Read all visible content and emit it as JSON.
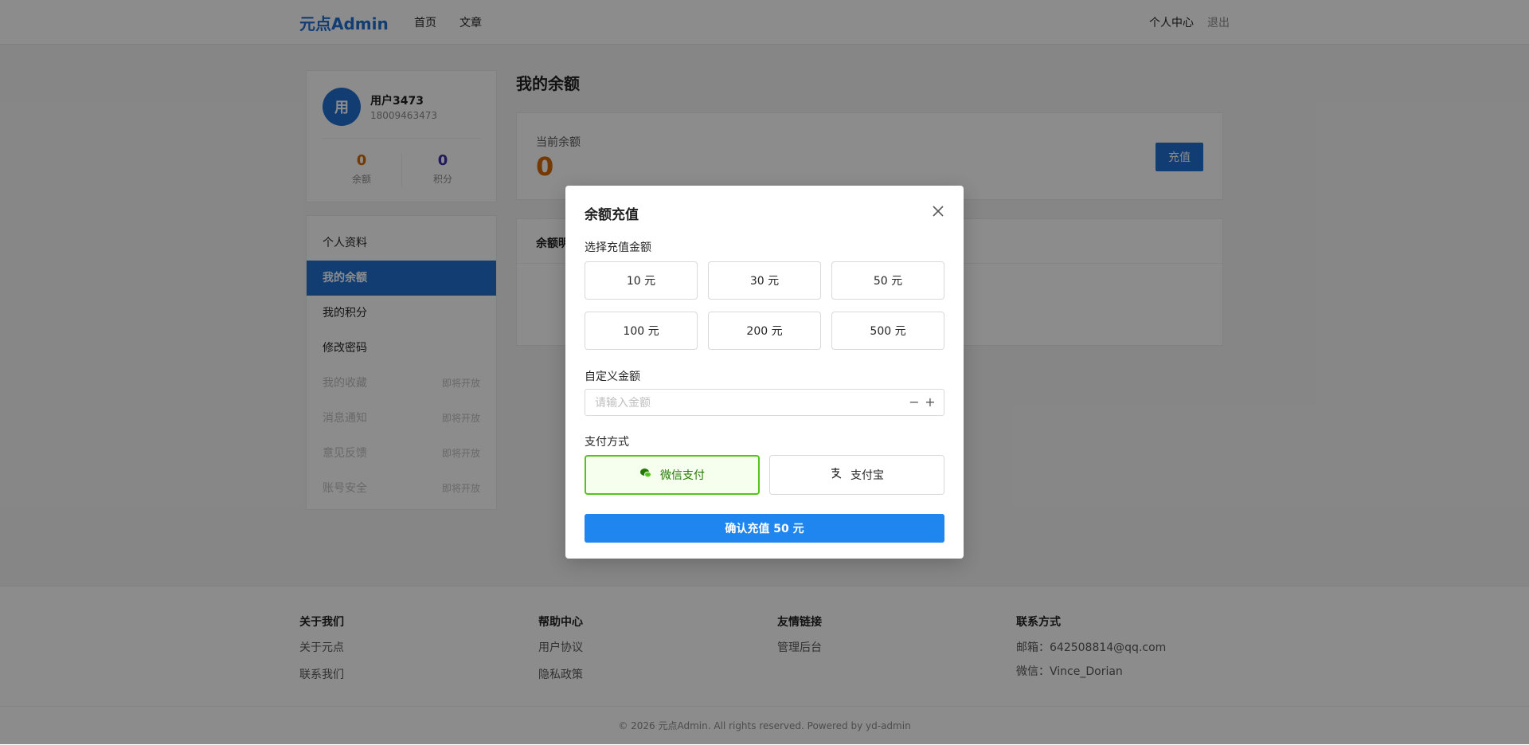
{
  "header": {
    "logo": "元点Admin",
    "nav": [
      "首页",
      "文章"
    ],
    "user_center": "个人中心",
    "logout": "退出"
  },
  "profile": {
    "avatar_char": "用",
    "name": "用户3473",
    "phone": "18009463473",
    "balance_value": "0",
    "balance_label": "余额",
    "points_value": "0",
    "points_label": "积分"
  },
  "menu": {
    "items": [
      {
        "label": "个人资料"
      },
      {
        "label": "我的余额"
      },
      {
        "label": "我的积分"
      },
      {
        "label": "修改密码"
      },
      {
        "label": "我的收藏",
        "badge": "即将开放"
      },
      {
        "label": "消息通知",
        "badge": "即将开放"
      },
      {
        "label": "意见反馈",
        "badge": "即将开放"
      },
      {
        "label": "账号安全",
        "badge": "即将开放"
      }
    ]
  },
  "main": {
    "title": "我的余额",
    "current_balance_label": "当前余额",
    "current_balance_value": "0",
    "recharge_button": "充值",
    "detail_title": "余额明"
  },
  "modal": {
    "title": "余额充值",
    "amount_label": "选择充值金额",
    "amounts": [
      "10 元",
      "30 元",
      "50 元",
      "100 元",
      "200 元",
      "500 元"
    ],
    "custom_label": "自定义金额",
    "custom_placeholder": "请输入金额",
    "pay_label": "支付方式",
    "wechat": "微信支付",
    "alipay": "支付宝",
    "confirm": "确认充值 50 元"
  },
  "footer": {
    "about_title": "关于我们",
    "about_links": [
      "关于元点",
      "联系我们"
    ],
    "help_title": "帮助中心",
    "help_links": [
      "用户协议",
      "隐私政策"
    ],
    "friend_title": "友情链接",
    "friend_links": [
      "管理后台"
    ],
    "contact_title": "联系方式",
    "contact_email": "邮箱：642508814@qq.com",
    "contact_wechat": "微信：Vince_Dorian",
    "copyright": "© 2026 元点Admin. All rights reserved. Powered by yd-admin"
  },
  "colors": {
    "primary": "#1f6fd1",
    "confirm": "#1f86f0",
    "balance": "#d46b08",
    "points": "#3b2fa8",
    "wechat": "#52c41a"
  }
}
